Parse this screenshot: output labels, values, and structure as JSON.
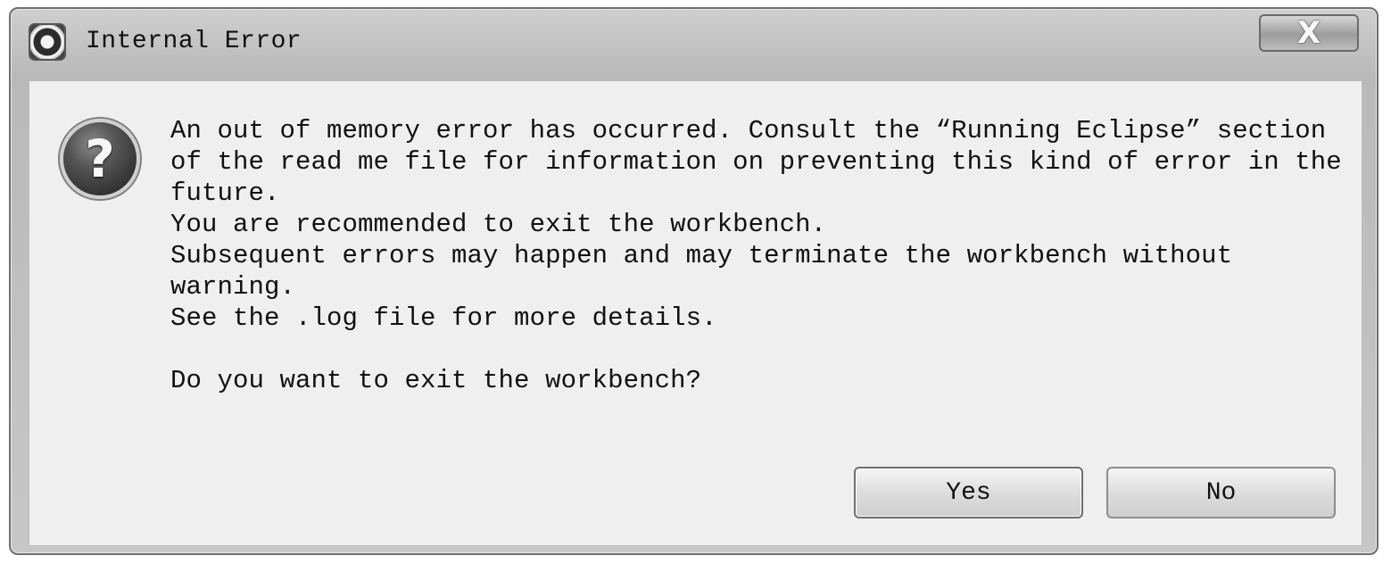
{
  "window": {
    "title": "Internal Error",
    "close_label": "X",
    "icon": "eclipse-icon"
  },
  "dialog": {
    "icon": "question-icon",
    "icon_symbol": "?",
    "message_lines": [
      "An out of memory error has occurred. Consult the “Running Eclipse” section",
      "of the read me file for information on preventing this kind of error in the",
      "future.",
      "You are recommended to exit the workbench.",
      "Subsequent errors may happen and may terminate the workbench without",
      "warning.",
      "See the .log file for more details.",
      "",
      "Do you want to exit the workbench?"
    ]
  },
  "buttons": {
    "yes_label": "Yes",
    "no_label": "No"
  }
}
